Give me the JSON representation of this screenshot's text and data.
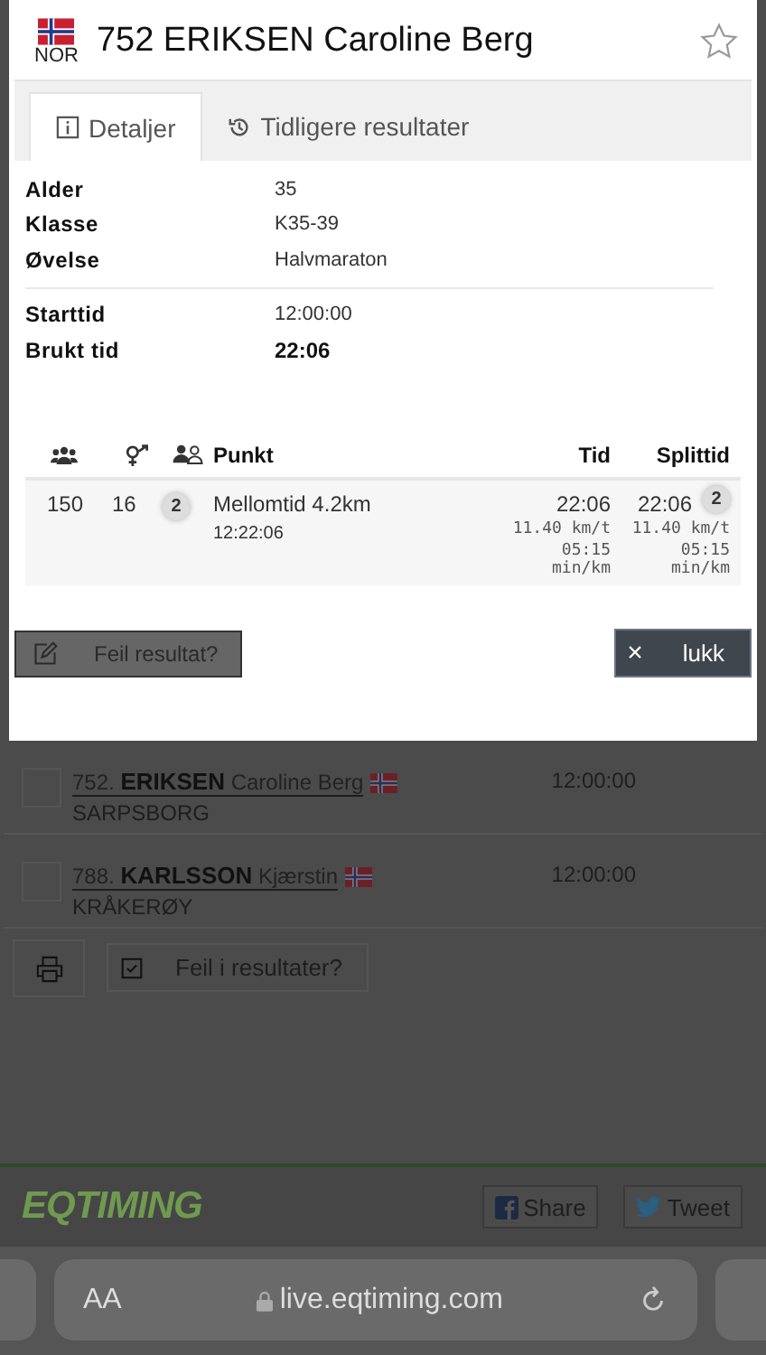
{
  "modal": {
    "country": "NOR",
    "title": "752 ERIKSEN Caroline Berg",
    "favorite": false,
    "tabs": [
      {
        "label": "Detaljer",
        "selected": true
      },
      {
        "label": "Tidligere resultater",
        "selected": false
      }
    ],
    "details": [
      {
        "label": "Alder",
        "value": "35",
        "bold": false
      },
      {
        "label": "Klasse",
        "value": "K35-39",
        "bold": false
      },
      {
        "label": "Øvelse",
        "value": "Halvmaraton",
        "bold": false
      },
      {
        "label": "Starttid",
        "value": "12:00:00",
        "bold": false,
        "divider_before": true
      },
      {
        "label": "Brukt tid",
        "value": "22:06",
        "bold": true
      }
    ],
    "splits": {
      "columns": [
        "Punkt",
        "Tid",
        "Splittid"
      ],
      "rows": [
        {
          "overall": "150",
          "gender": "16",
          "class_rank": "2",
          "point": "Mellomtid 4.2km",
          "clock": "12:22:06",
          "time": "22:06",
          "time_speed": "11.40 km/t",
          "time_pace": "05:15 min/km",
          "split": "22:06",
          "split_rank": "2",
          "split_speed": "11.40 km/t",
          "split_pace": "05:15 min/km"
        }
      ]
    },
    "report_button": {
      "label": "Feil resultat?",
      "disabled": true
    },
    "close_button": {
      "icon": "×",
      "label": "lukk"
    }
  },
  "results": [
    {
      "name": "752. **ERIKSEN** Caroline Berg",
      "club": "SARPSBORG",
      "time": "12:00:00",
      "checked": false
    },
    {
      "name": "788. **KARLSSON** Kjærstin",
      "club": "KRÅKERØY",
      "time": "12:00:00",
      "checked": false
    }
  ],
  "report_errors_button": "Feil i resultater?",
  "footer": {
    "logo": "EQTIMING",
    "share": "Share",
    "tweet": "Tweet"
  },
  "browser": {
    "text_size": "AA",
    "url": "live.eqtiming.com"
  }
}
